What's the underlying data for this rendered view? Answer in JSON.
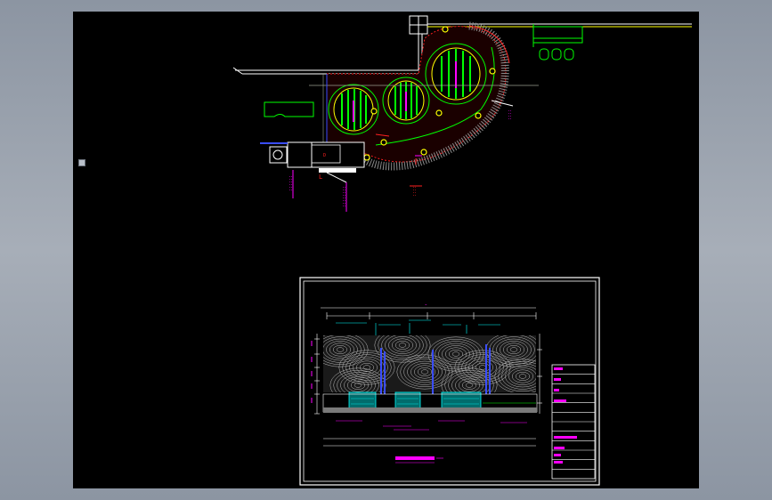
{
  "colors": {
    "canvas": "#000000",
    "chrome": "#9aa2ad",
    "white": "#ffffff",
    "yellow": "#ffff00",
    "green": "#00ff00",
    "red": "#ff2020",
    "magenta": "#ff00ff",
    "cyan": "#00ffff",
    "blue": "#3a4dff",
    "grey": "#9a9a9a"
  },
  "elevation_sheet": {
    "title_block_rows": 12,
    "pools": 3
  }
}
